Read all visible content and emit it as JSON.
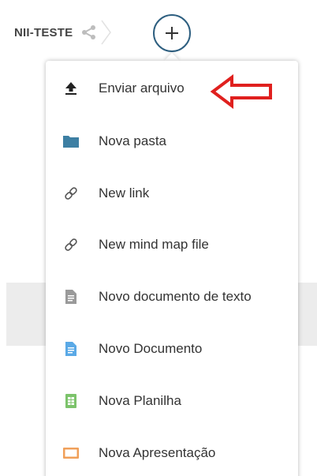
{
  "breadcrumb": {
    "folder_name": "NII-TESTE"
  },
  "add_button": {
    "icon": "plus-icon"
  },
  "menu": {
    "items": [
      {
        "label": "Enviar arquivo",
        "icon": "upload-icon",
        "icon_color": "#222222"
      },
      {
        "label": "Nova pasta",
        "icon": "folder-icon",
        "icon_color": "#3d7fa3"
      },
      {
        "label": "New link",
        "icon": "link-icon",
        "icon_color": "#555555"
      },
      {
        "label": "New mind map file",
        "icon": "link-icon",
        "icon_color": "#555555"
      },
      {
        "label": "Novo documento de texto",
        "icon": "text-file-icon",
        "icon_color": "#9a9a9a"
      },
      {
        "label": "Novo Documento",
        "icon": "document-icon",
        "icon_color": "#5aa9e6"
      },
      {
        "label": "Nova Planilha",
        "icon": "spreadsheet-icon",
        "icon_color": "#7cc36b"
      },
      {
        "label": "Nova Apresentação",
        "icon": "presentation-icon",
        "icon_color": "#f0a05a"
      }
    ]
  },
  "annotation": {
    "arrow_color": "#e0201e"
  }
}
